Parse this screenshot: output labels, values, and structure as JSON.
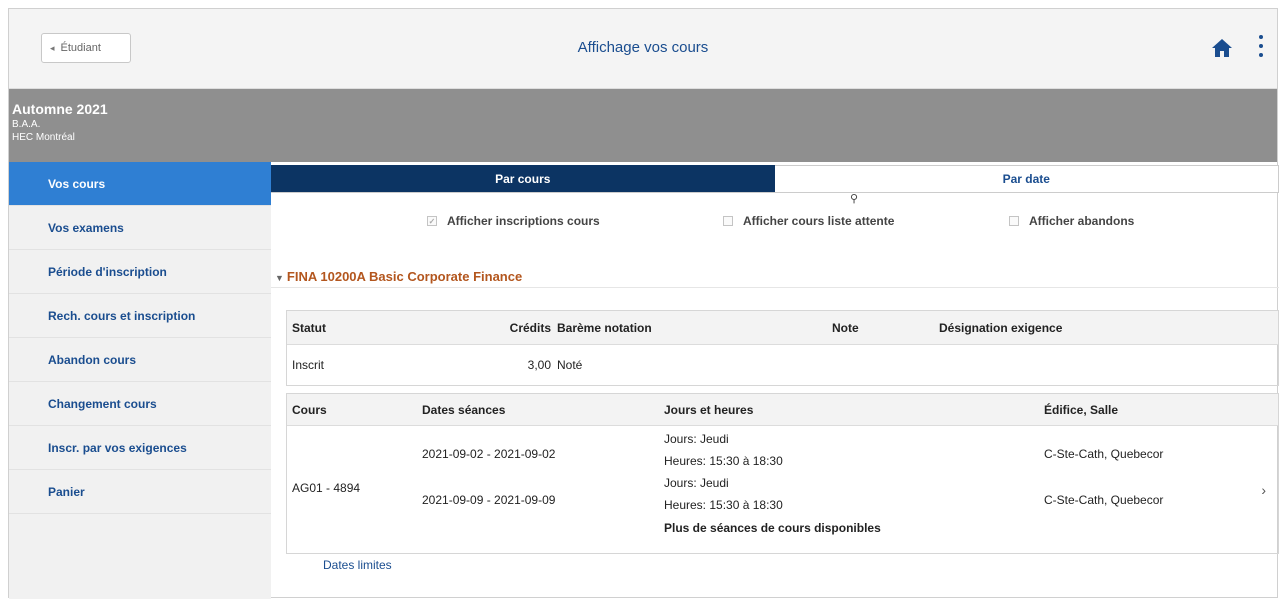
{
  "header": {
    "back_label": "Étudiant",
    "title": "Affichage vos cours"
  },
  "term": {
    "name": "Automne 2021",
    "program": "B.A.A.",
    "institution": "HEC Montréal"
  },
  "sidebar": {
    "items": [
      {
        "label": "Vos cours",
        "active": true
      },
      {
        "label": "Vos examens"
      },
      {
        "label": "Période d'inscription"
      },
      {
        "label": "Rech. cours et inscription"
      },
      {
        "label": "Abandon cours"
      },
      {
        "label": "Changement cours"
      },
      {
        "label": "Inscr. par vos exigences"
      },
      {
        "label": "Panier"
      }
    ]
  },
  "tabs": [
    {
      "label": "Par cours",
      "active": true
    },
    {
      "label": "Par date",
      "active": false
    }
  ],
  "filters": [
    {
      "label": "Afficher inscriptions cours",
      "checked": true
    },
    {
      "label": "Afficher cours liste attente",
      "checked": false
    },
    {
      "label": "Afficher abandons",
      "checked": false
    }
  ],
  "course": {
    "title": "FINA 10200A Basic Corporate Finance",
    "summary": {
      "headers": [
        "Statut",
        "Crédits",
        "Barème notation",
        "Note",
        "Désignation exigence"
      ],
      "row": [
        "Inscrit",
        "3,00",
        "Noté",
        "",
        ""
      ]
    },
    "sections": {
      "headers": [
        "Cours",
        "Dates séances",
        "Jours et heures",
        "Édifice, Salle"
      ],
      "class": "AG01 - 4894",
      "meetings": [
        {
          "dates": "2021-09-02 - 2021-09-02",
          "days": "Jours: Jeudi",
          "hours": "Heures: 15:30 à 18:30",
          "room": "C-Ste-Cath, Quebecor"
        },
        {
          "dates": "2021-09-09 - 2021-09-09",
          "days": "Jours: Jeudi",
          "hours": "Heures: 15:30 à 18:30",
          "room": "C-Ste-Cath, Quebecor"
        }
      ],
      "more_label": "Plus de séances de cours disponibles"
    }
  },
  "deadlines_label": "Dates limites",
  "colors": {
    "accent": "#1a4d8f",
    "active_tab": "#0c3463",
    "sidebar_active": "#2f7fd3",
    "course_title": "#b3561e",
    "term_band": "#8f8f8f"
  }
}
